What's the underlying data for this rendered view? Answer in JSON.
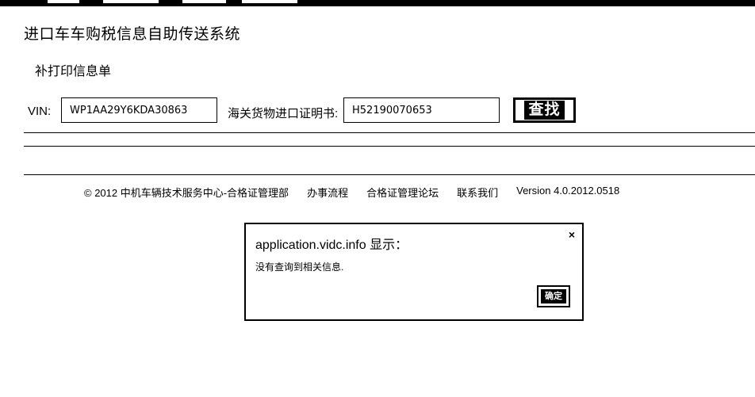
{
  "system_title": "进口车车购税信息自助传送系统",
  "subtitle": "补打印信息单",
  "search": {
    "vin_label": "VIN:",
    "vin_value": "WP1AA29Y6KDA30863",
    "cert_label": "海关货物进口证明书:",
    "cert_value": "H52190070653",
    "search_button": "查找"
  },
  "footer": {
    "copyright": "© 2012 中机车辆技术服务中心-合格证管理部",
    "links": [
      "办事流程",
      "合格证管理论坛",
      "联系我们"
    ],
    "version": "Version 4.0.2012.0518"
  },
  "dialog": {
    "title": "application.vidc.info 显示：",
    "message": "没有查询到相关信息.",
    "close_glyph": "×",
    "ok_button": "确定"
  }
}
